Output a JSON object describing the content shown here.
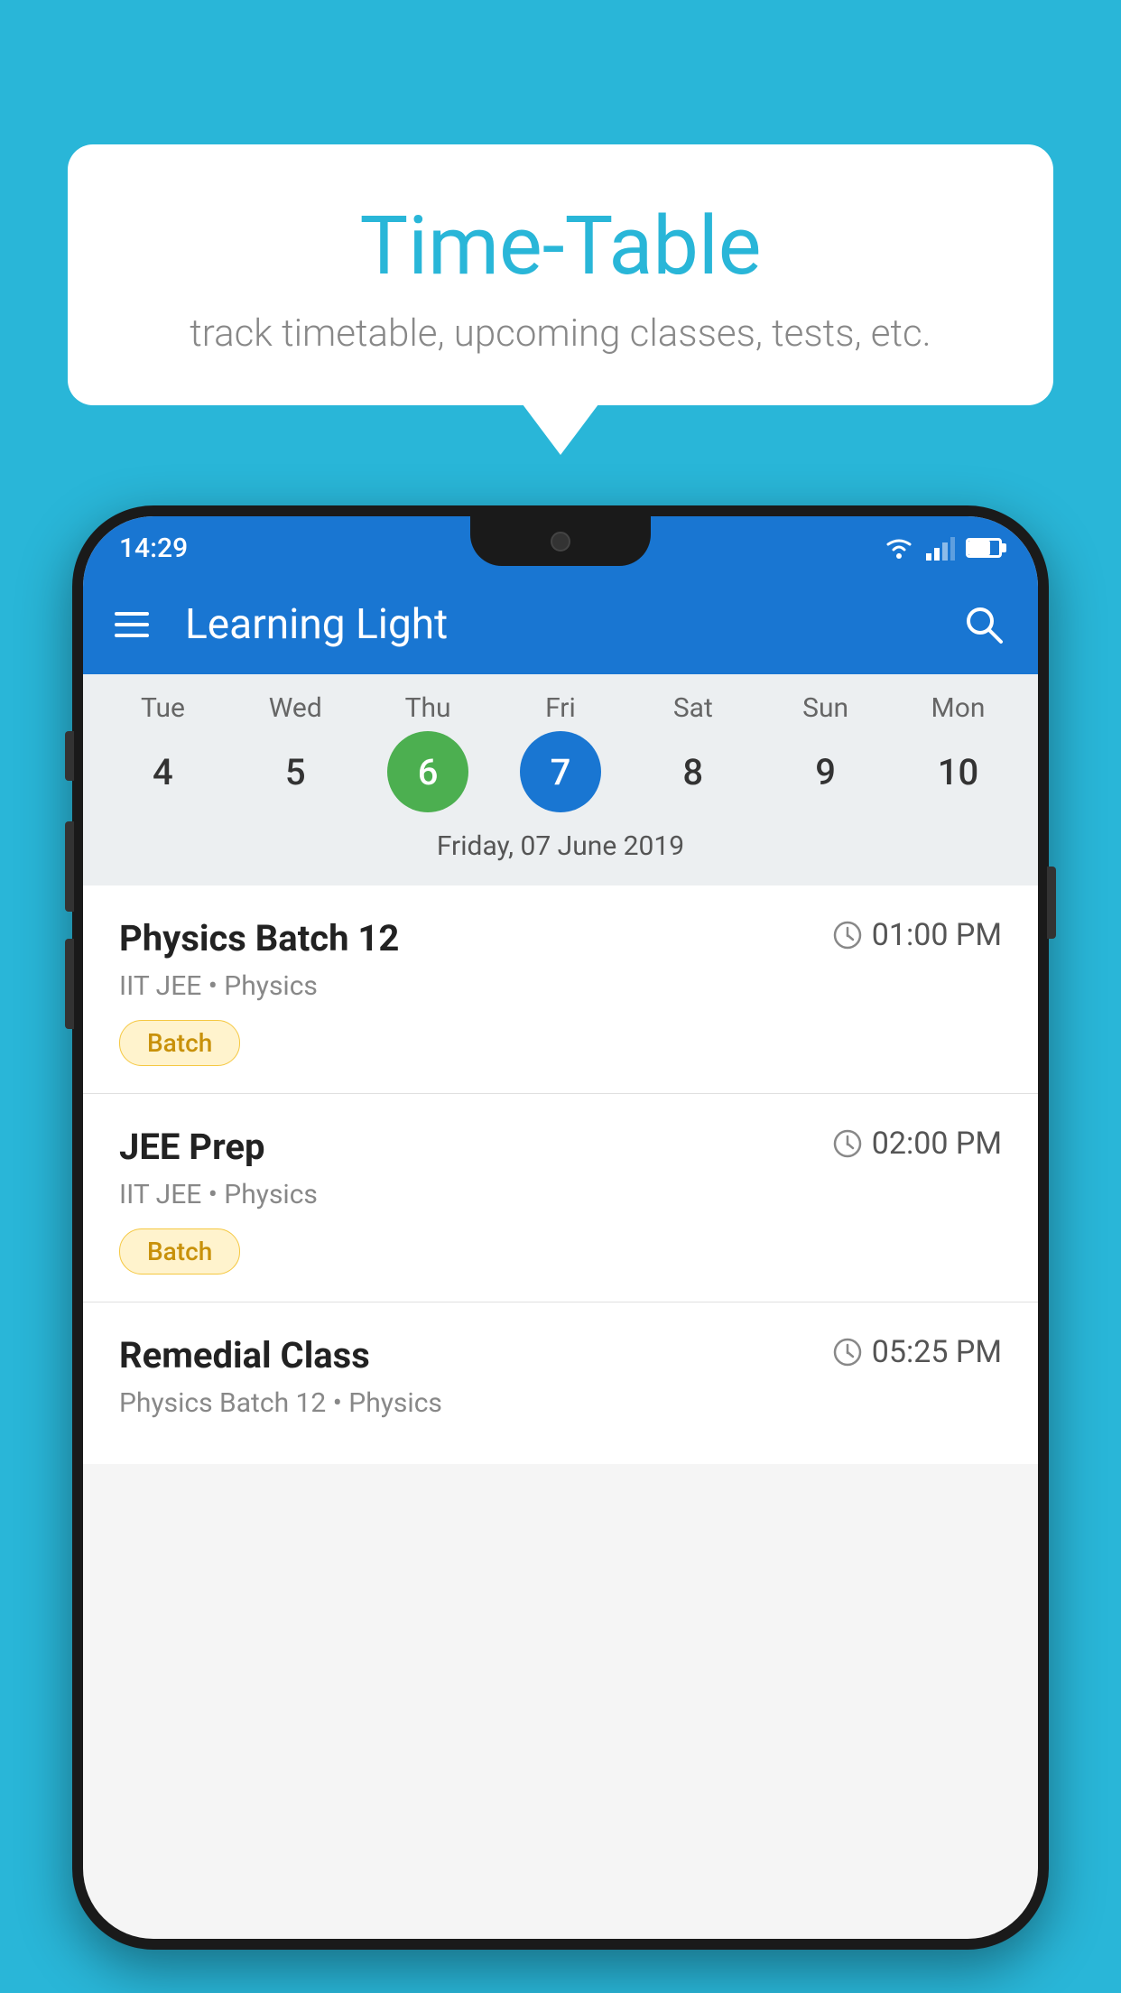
{
  "page": {
    "background_color": "#29b6d8"
  },
  "bubble": {
    "title": "Time-Table",
    "subtitle": "track timetable, upcoming classes, tests, etc."
  },
  "status_bar": {
    "time": "14:29"
  },
  "app_bar": {
    "title": "Learning Light",
    "menu_icon": "hamburger-icon",
    "search_icon": "search-icon"
  },
  "calendar": {
    "selected_date_label": "Friday, 07 June 2019",
    "days": [
      {
        "label": "Tue",
        "num": "4",
        "state": "normal"
      },
      {
        "label": "Wed",
        "num": "5",
        "state": "normal"
      },
      {
        "label": "Thu",
        "num": "6",
        "state": "today"
      },
      {
        "label": "Fri",
        "num": "7",
        "state": "selected"
      },
      {
        "label": "Sat",
        "num": "8",
        "state": "normal"
      },
      {
        "label": "Sun",
        "num": "9",
        "state": "normal"
      },
      {
        "label": "Mon",
        "num": "10",
        "state": "normal"
      }
    ]
  },
  "classes": [
    {
      "name": "Physics Batch 12",
      "time": "01:00 PM",
      "meta": "IIT JEE • Physics",
      "badge": "Batch"
    },
    {
      "name": "JEE Prep",
      "time": "02:00 PM",
      "meta": "IIT JEE • Physics",
      "badge": "Batch"
    },
    {
      "name": "Remedial Class",
      "time": "05:25 PM",
      "meta": "Physics Batch 12 • Physics",
      "badge": ""
    }
  ]
}
